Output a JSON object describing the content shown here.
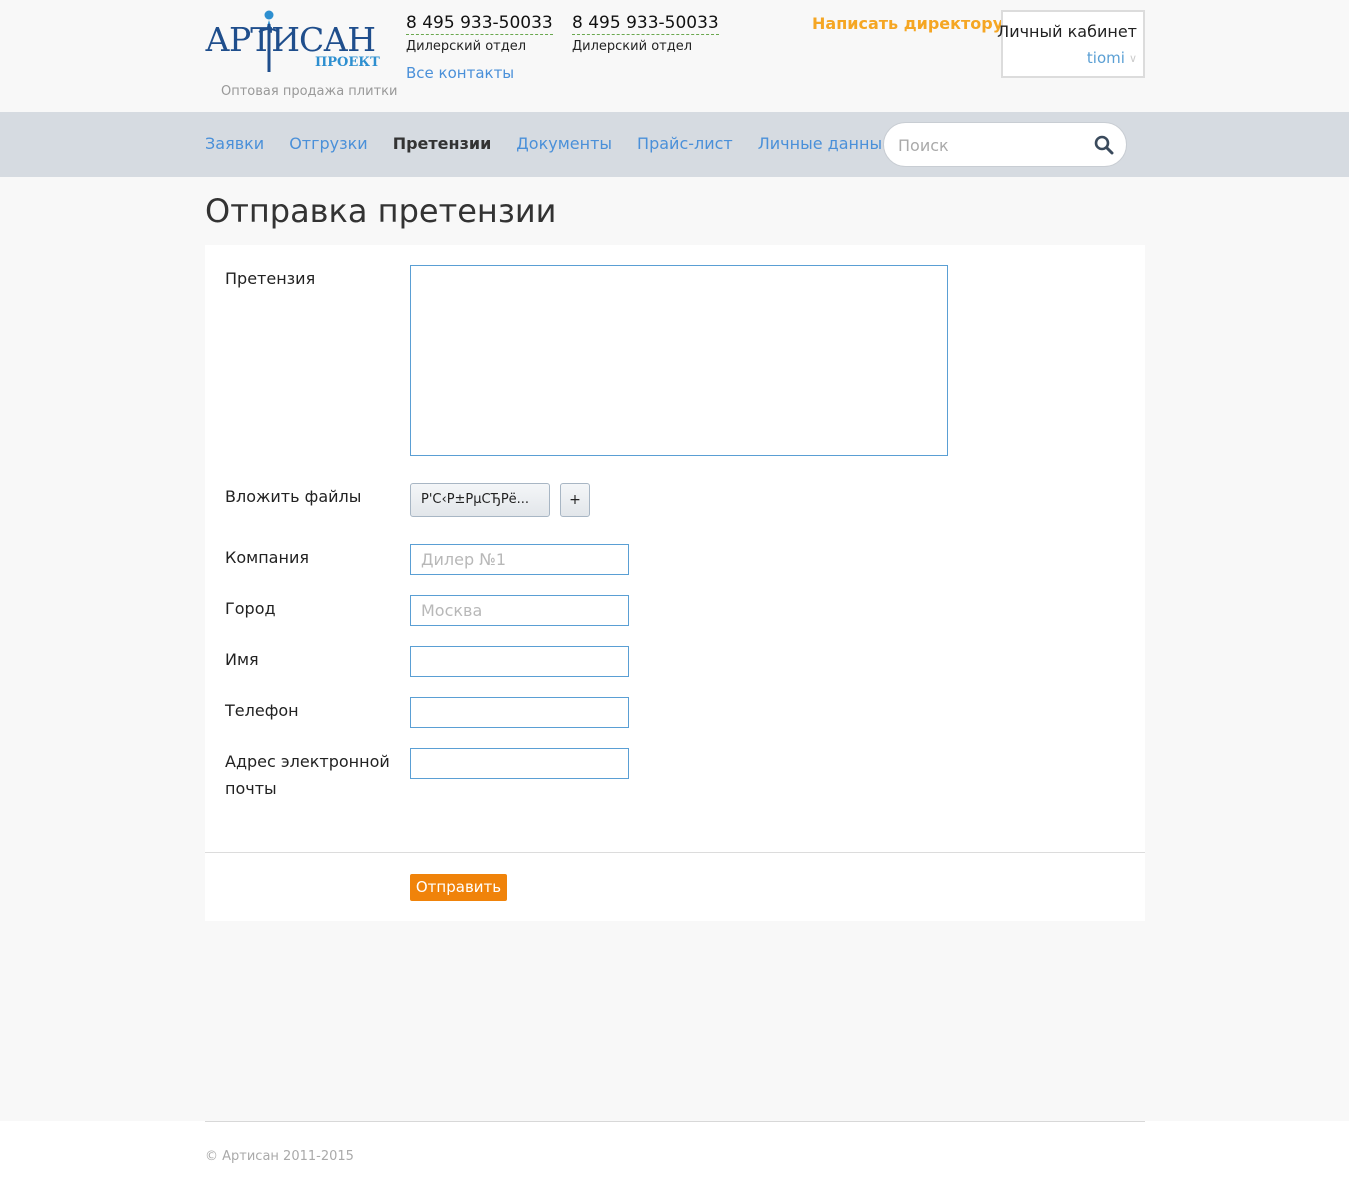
{
  "header": {
    "logo": {
      "word": "АРТИСАН",
      "sub": "ПРОЕКТ",
      "tagline": "Оптовая продажа плитки"
    },
    "phones": [
      {
        "number": "8 495 933-50033",
        "desc": "Дилерский отдел"
      },
      {
        "number": "8 495 933-50033",
        "desc": "Дилерский отдел"
      }
    ],
    "all_contacts": "Все контакты",
    "write_director": "Написать директору",
    "account": {
      "title": "Личный кабинет",
      "user": "tiomi"
    }
  },
  "nav": {
    "items": [
      {
        "label": "Заявки",
        "active": false
      },
      {
        "label": "Отгрузки",
        "active": false
      },
      {
        "label": "Претензии",
        "active": true
      },
      {
        "label": "Документы",
        "active": false
      },
      {
        "label": "Прайс-лист",
        "active": false
      },
      {
        "label": "Личные данные",
        "active": false
      }
    ],
    "search": {
      "placeholder": "Поиск"
    }
  },
  "page": {
    "title": "Отправка претензии"
  },
  "form": {
    "claim_label": "Претензия",
    "claim_value": "",
    "files_label": "Вложить файлы",
    "file_button": "Р'С‹Р±РµСЂРё...",
    "plus_button": "+",
    "company_label": "Компания",
    "company_placeholder": "Дилер №1",
    "city_label": "Город",
    "city_placeholder": "Москва",
    "name_label": "Имя",
    "phone_label": "Телефон",
    "email_label_line1": "Адрес электронной",
    "email_label_line2": "почты",
    "submit": "Отправить"
  },
  "footer": {
    "copyright": "© Артисан 2011-2015"
  },
  "colors": {
    "accent_blue": "#4a90d9",
    "director_orange": "#f5a623",
    "submit_orange": "#f0830a",
    "navbar_bg": "#d6dbe1"
  }
}
